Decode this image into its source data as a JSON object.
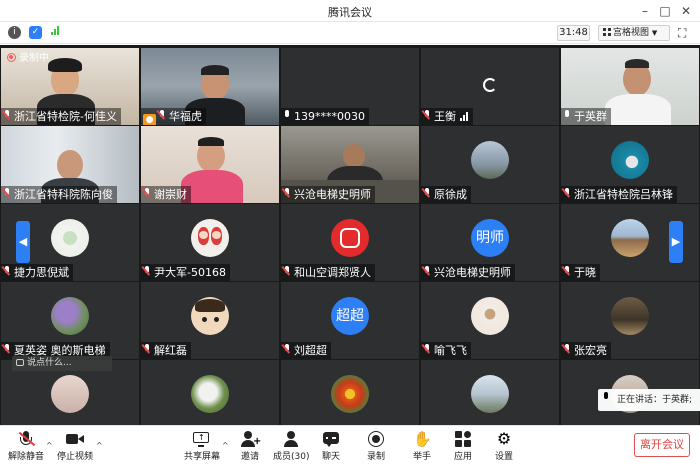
{
  "window": {
    "title": "腾讯会议"
  },
  "infobar": {
    "timer": "31:48",
    "view_label": "宫格视图"
  },
  "recording": {
    "label": "录制中"
  },
  "tiles": [
    {
      "name": "浙江省特检院-何佳义"
    },
    {
      "name": "华福虎"
    },
    {
      "name": "139****0030"
    },
    {
      "name": "王衡"
    },
    {
      "name": "于英群"
    },
    {
      "name": "浙江省特科院陈向俊"
    },
    {
      "name": "谢崇财"
    },
    {
      "name": "兴沧电梯史明师"
    },
    {
      "name": "原徐成"
    },
    {
      "name": "浙江省特检院吕林锋"
    },
    {
      "name": "捷力思倪斌"
    },
    {
      "name": "尹大军-50168"
    },
    {
      "name": "和山空调郑贤人"
    },
    {
      "name": "兴沧电梯史明师",
      "avatar_text": "明师"
    },
    {
      "name": "于晓"
    },
    {
      "name": "夏英姿 奥的斯电梯"
    },
    {
      "name": "解红磊"
    },
    {
      "name": "刘超超",
      "avatar_text": "超超"
    },
    {
      "name": "喻飞飞"
    },
    {
      "name": "张宏亮"
    },
    {
      "name": ""
    },
    {
      "name": ""
    },
    {
      "name": ""
    },
    {
      "name": ""
    },
    {
      "name": ""
    }
  ],
  "chat": {
    "placeholder": "说点什么..."
  },
  "speaking": {
    "text": "正在讲话：于英群;"
  },
  "toolbar": {
    "unmute": "解除静音",
    "stop_video": "停止视频",
    "share": "共享屏幕",
    "invite": "邀请",
    "members": "成员(30)",
    "chat": "聊天",
    "record": "录制",
    "raise_hand": "举手",
    "apps": "应用",
    "settings": "设置",
    "leave": "离开会议"
  },
  "colors": {
    "accent": "#2d7ff5",
    "danger": "#e04040",
    "tile_bg": "#2d2f31"
  }
}
